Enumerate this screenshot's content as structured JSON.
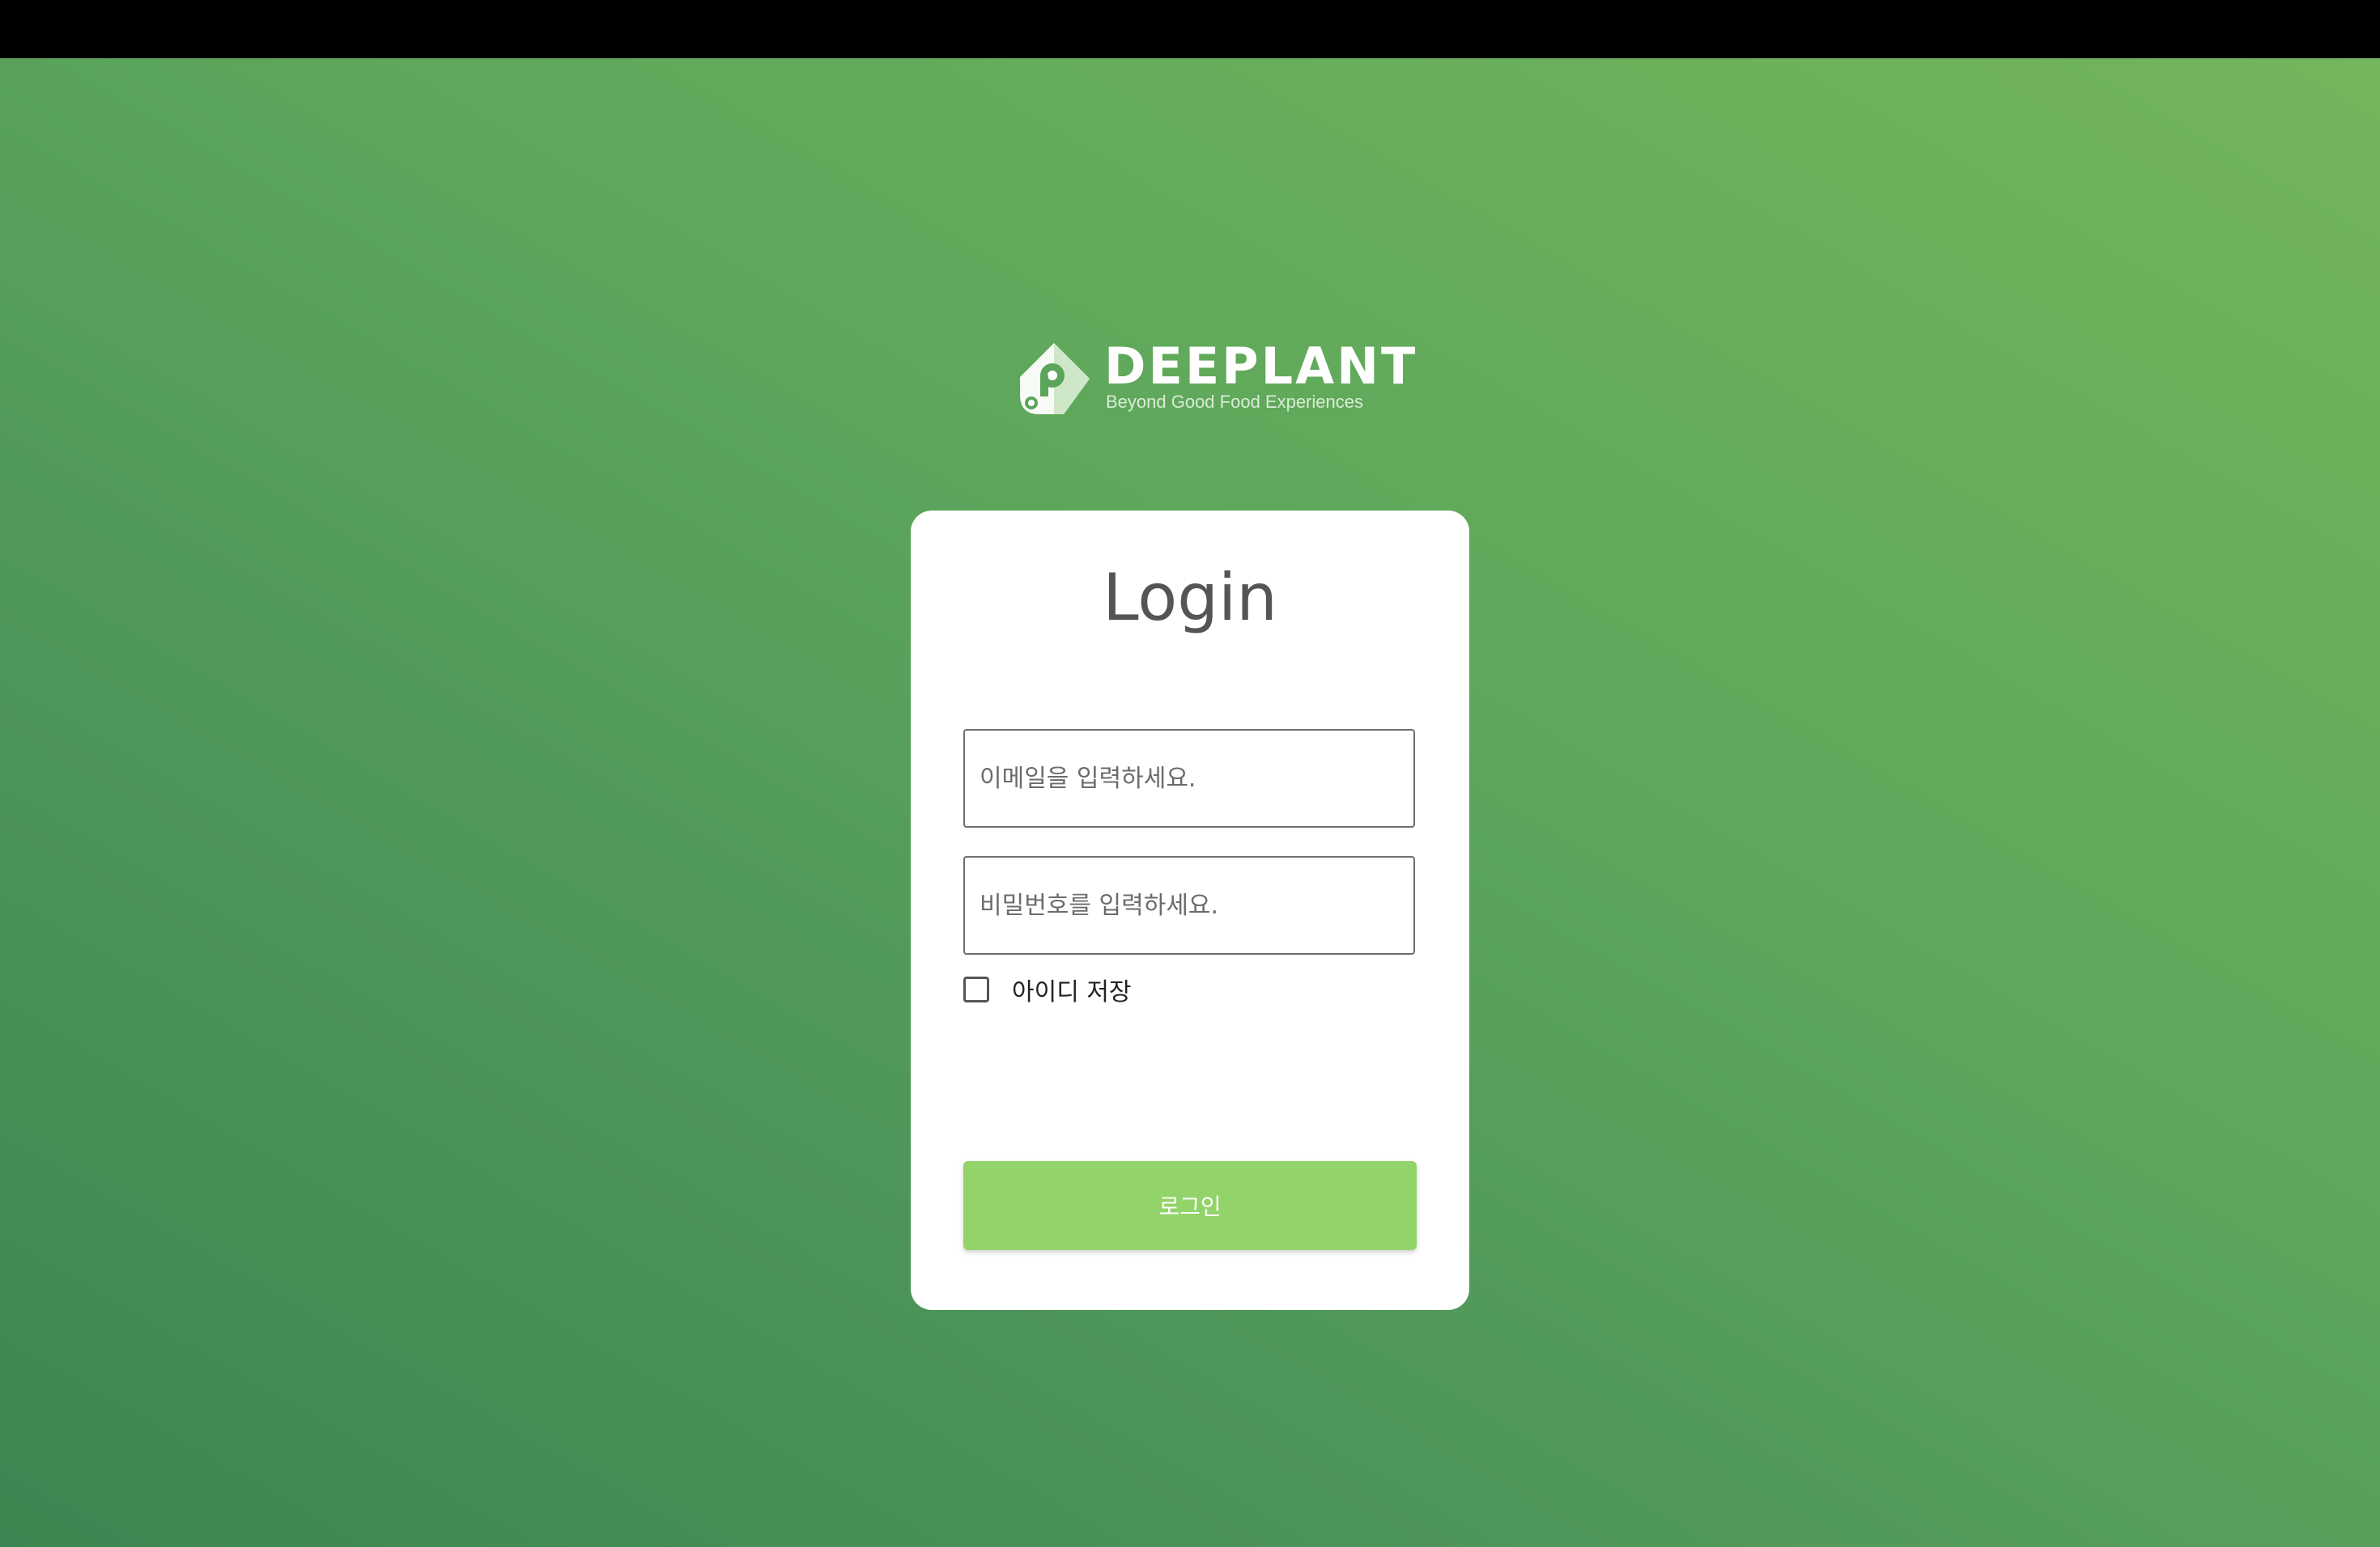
{
  "logo": {
    "wordmark": "DEEPLANT",
    "tagline": "Beyond Good Food Experiences"
  },
  "login": {
    "title": "Login",
    "email_placeholder": "이메일을 입력하세요.",
    "email_value": "",
    "password_placeholder": "비밀번호를 입력하세요.",
    "password_value": "",
    "remember_label": "아이디 저장",
    "remember_checked": false,
    "submit_label": "로그인"
  },
  "colors": {
    "top_bar": "#000000",
    "gradient_dark": "#3d8552",
    "gradient_light": "#74b55d",
    "card": "#ffffff",
    "button": "#93d46a",
    "title_text": "#555555"
  },
  "icons": [
    "deeplant-logo-icon"
  ]
}
